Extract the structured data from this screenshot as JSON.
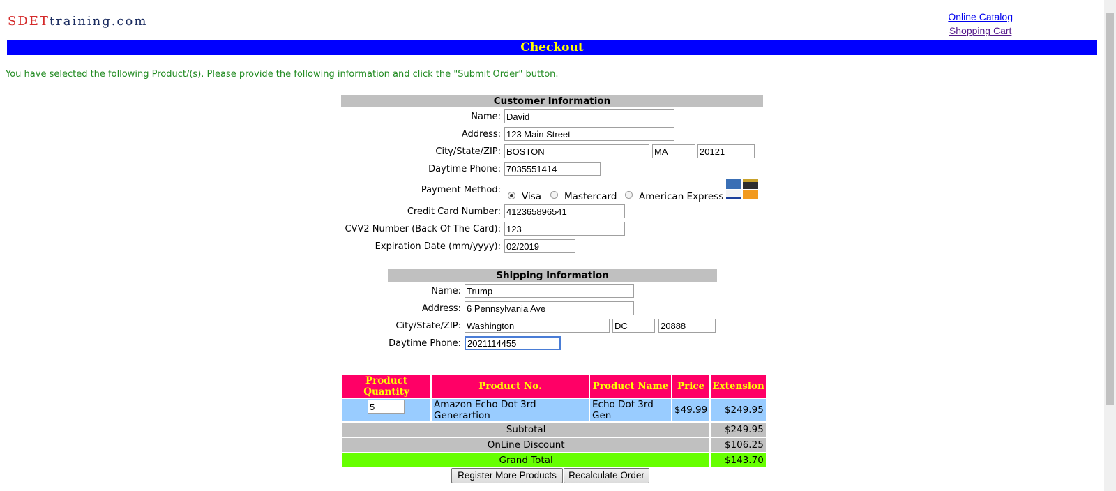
{
  "logo": {
    "part1": "SDET",
    "part2": "training.com"
  },
  "nav": {
    "online_catalog": "Online Catalog",
    "shopping_cart": "Shopping Cart"
  },
  "banner": "Checkout",
  "intro": "You have selected the following Product/(s). Please provide the following information and click the \"Submit Order\" button.",
  "customer": {
    "header": "Customer Information",
    "name_label": "Name:",
    "name": "David",
    "address_label": "Address:",
    "address": "123 Main Street",
    "csz_label": "City/State/ZIP:",
    "city": "BOSTON",
    "state": "MA",
    "zip": "20121",
    "phone_label": "Daytime Phone:",
    "phone": "7035551414",
    "payment_label": "Payment Method:",
    "payment_options": [
      "Visa",
      "Mastercard",
      "American Express"
    ],
    "payment_selected": "Visa",
    "cc_label": "Credit Card Number:",
    "cc": "412365896541",
    "cvv_label": "CVV2 Number (Back Of The Card):",
    "cvv": "123",
    "exp_label": "Expiration Date (mm/yyyy):",
    "exp": "02/2019"
  },
  "shipping": {
    "header": "Shipping Information",
    "name_label": "Name:",
    "name": "Trump",
    "address_label": "Address:",
    "address": "6 Pennsylvania Ave",
    "csz_label": "City/State/ZIP:",
    "city": "Washington",
    "state": "DC",
    "zip": "20888",
    "phone_label": "Daytime Phone:",
    "phone": "2021114455"
  },
  "order": {
    "headers": [
      "Product Quantity",
      "Product No.",
      "Product Name",
      "Price",
      "Extension"
    ],
    "item": {
      "qty": "5",
      "product_no": "Amazon Echo Dot 3rd Generartion",
      "product_name": "Echo Dot 3rd Gen",
      "price": "$49.99",
      "extension": "$249.95"
    },
    "subtotal_label": "Subtotal",
    "subtotal": "$249.95",
    "discount_label": "OnLine Discount",
    "discount": "$106.25",
    "grand_total_label": "Grand Total",
    "grand_total": "$143.70"
  },
  "buttons": {
    "register_more": "Register More Products",
    "recalculate": "Recalculate Order"
  },
  "colors": {
    "banner": "#0000ff",
    "banner_text": "#ffff00",
    "table_header": "#ff0066",
    "row_blue": "#99ccff",
    "grand_total": "#66ff00",
    "intro": "#228b22"
  }
}
